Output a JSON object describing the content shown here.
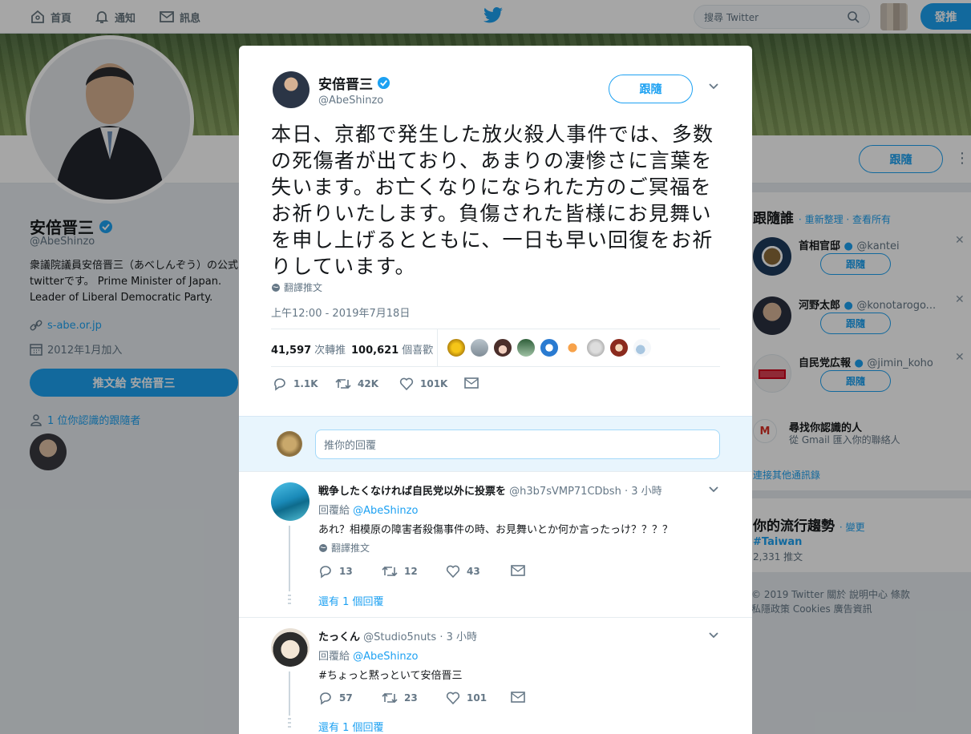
{
  "nav": {
    "home": "首頁",
    "notifications": "通知",
    "messages": "訊息",
    "search_placeholder": "搜尋 Twitter",
    "tweet_button": "發推"
  },
  "profile": {
    "name": "安倍晋三",
    "handle": "@AbeShinzo",
    "bio": "衆議院議員安倍晋三（あべしんぞう）の公式twitterです。 Prime Minister of Japan. Leader of Liberal Democratic Party.",
    "url": "s-abe.or.jp",
    "joined": "2012年1月加入",
    "tweet_to": "推文給 安倍晋三",
    "known_followers": "1 位你認識的跟隨者",
    "follow_label": "跟隨"
  },
  "who_to_follow": {
    "title": "跟隨誰",
    "refresh": "重新整理",
    "view_all": "查看所有",
    "items": [
      {
        "name": "首相官邸",
        "handle": "@kantei",
        "follow": "跟隨"
      },
      {
        "name": "河野太郎",
        "handle": "@konotarogo...",
        "follow": "跟隨"
      },
      {
        "name": "自民党広報",
        "handle": "@jimin_koho",
        "follow": "跟隨"
      }
    ],
    "find_people_title": "尋找你認識的人",
    "find_people_sub": "從 Gmail 匯入你的聯絡人",
    "connect_other": "連接其他通訊錄"
  },
  "trends": {
    "title": "你的流行趨勢",
    "change": "變更",
    "tag": "#Taiwan",
    "count": "2,331 推文"
  },
  "footer": {
    "line1": "© 2019 Twitter   關於   說明中心   條款",
    "line2": "私隱政策   Cookies   廣告資訊"
  },
  "tweet": {
    "name": "安倍晋三",
    "handle": "@AbeShinzo",
    "follow": "跟隨",
    "text": "本日、京都で発生した放火殺人事件では、多数の死傷者が出ており、あまりの凄惨さに言葉を失います。お亡くなりになられた方のご冥福をお祈りいたします。負傷された皆様にお見舞いを申し上げるとともに、一日も早い回復をお祈りしています。",
    "translate": "翻譯推文",
    "timestamp": "上午12:00 - 2019年7月18日",
    "retweets_count": "41,597",
    "retweets_label": "次轉推",
    "likes_count": "100,621",
    "likes_label": "個喜歡",
    "reply_count": "1.1K",
    "retweet_action_count": "42K",
    "like_action_count": "101K",
    "reply_placeholder": "推你的回覆"
  },
  "replies": [
    {
      "name": "戦争したくなければ自民党以外に投票を",
      "handle": "@h3b7sVMP71CDbsh",
      "time": "· 3 小時",
      "reply_to_label": "回覆給",
      "reply_to": "@AbeShinzo",
      "text": "あれ？相模原の障害者殺傷事件の時、お見舞いとか何か言ったっけ？？？？",
      "translate": "翻譯推文",
      "replies": "13",
      "retweets": "12",
      "likes": "43",
      "more": "還有 1 個回覆"
    },
    {
      "name": "たっくん",
      "handle": "@Studio5nuts",
      "time": "· 3 小時",
      "reply_to_label": "回覆給",
      "reply_to": "@AbeShinzo",
      "text": "#ちょっと黙っといて安倍晋三",
      "replies": "57",
      "retweets": "23",
      "likes": "101",
      "more": "還有 1 個回覆"
    }
  ],
  "colors": {
    "accent": "#1da1f2",
    "muted": "#657786",
    "text": "#14171a"
  }
}
